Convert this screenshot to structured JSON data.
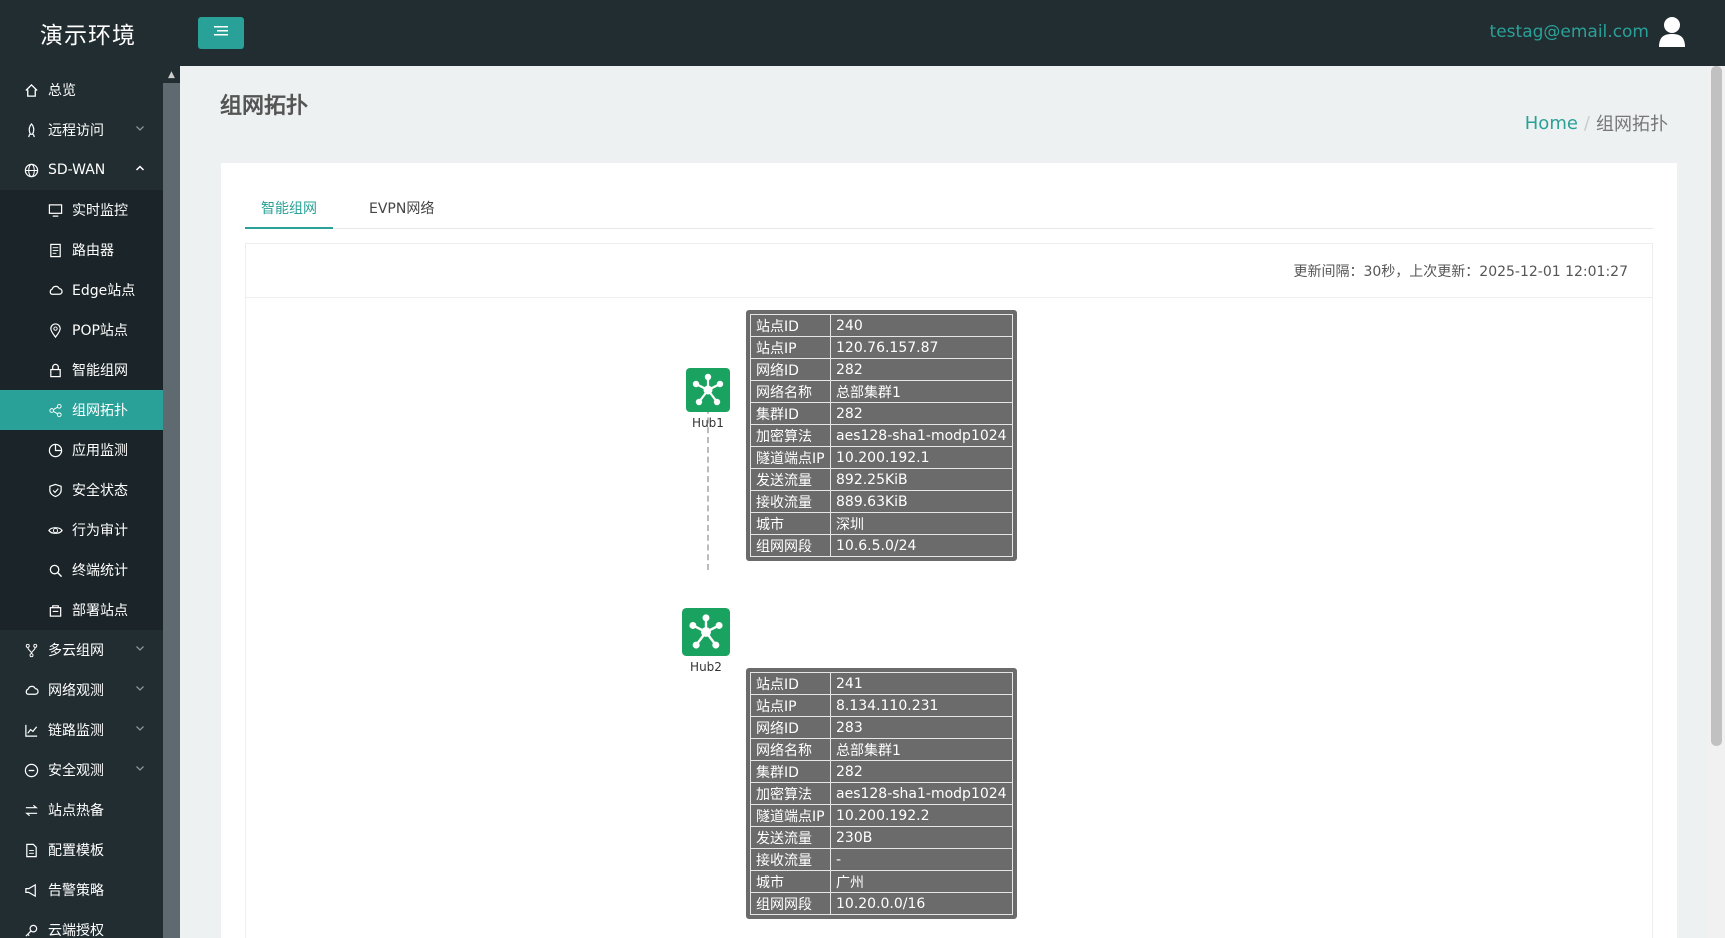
{
  "brand": "演示环境",
  "user": {
    "email": "testag@email.com"
  },
  "sidebar": {
    "items": [
      {
        "label": "总览",
        "icon": "home-icon"
      },
      {
        "label": "远程访问",
        "icon": "rocket-icon",
        "expandable": true
      },
      {
        "label": "SD-WAN",
        "icon": "globe-icon",
        "expandable": true,
        "expanded": true
      }
    ],
    "sdwan_sub": [
      {
        "label": "实时监控",
        "icon": "monitor-icon"
      },
      {
        "label": "路由器",
        "icon": "router-icon"
      },
      {
        "label": "Edge站点",
        "icon": "cloud-icon"
      },
      {
        "label": "POP站点",
        "icon": "location-pin-icon"
      },
      {
        "label": "智能组网",
        "icon": "lock-icon"
      },
      {
        "label": "组网拓扑",
        "icon": "share-nodes-icon",
        "active": true
      },
      {
        "label": "应用监测",
        "icon": "pie-chart-icon"
      },
      {
        "label": "安全状态",
        "icon": "shield-icon"
      },
      {
        "label": "行为审计",
        "icon": "eye-icon"
      },
      {
        "label": "终端统计",
        "icon": "search-icon"
      },
      {
        "label": "部署站点",
        "icon": "box-icon"
      }
    ],
    "bottom_items": [
      {
        "label": "多云组网",
        "icon": "fork-icon",
        "expandable": true
      },
      {
        "label": "网络观测",
        "icon": "cloud-icon",
        "expandable": true
      },
      {
        "label": "链路监测",
        "icon": "line-chart-icon",
        "expandable": true
      },
      {
        "label": "安全观测",
        "icon": "minus-circle-icon",
        "expandable": true
      },
      {
        "label": "站点热备",
        "icon": "swap-icon"
      },
      {
        "label": "配置模板",
        "icon": "file-icon"
      },
      {
        "label": "告警策略",
        "icon": "notification-icon"
      },
      {
        "label": "云端授权",
        "icon": "key-icon"
      }
    ]
  },
  "page": {
    "title": "组网拓扑"
  },
  "breadcrumb": {
    "home": "Home",
    "separator": "/",
    "current": "组网拓扑"
  },
  "tabs": [
    {
      "label": "智能组网",
      "active": true
    },
    {
      "label": "EVPN网络",
      "active": false
    }
  ],
  "update_info": "更新间隔：30秒，上次更新：2025-12-01 12:01:27",
  "topology": {
    "nodes": [
      {
        "label": "Hub1"
      },
      {
        "label": "Hub2"
      }
    ],
    "info_boxes": [
      {
        "rows": [
          {
            "k": "站点ID",
            "v": "240"
          },
          {
            "k": "站点IP",
            "v": "120.76.157.87"
          },
          {
            "k": "网络ID",
            "v": "282"
          },
          {
            "k": "网络名称",
            "v": "总部集群1"
          },
          {
            "k": "集群ID",
            "v": "282"
          },
          {
            "k": "加密算法",
            "v": "aes128-sha1-modp1024"
          },
          {
            "k": "隧道端点IP",
            "v": "10.200.192.1"
          },
          {
            "k": "发送流量",
            "v": "892.25KiB"
          },
          {
            "k": "接收流量",
            "v": "889.63KiB"
          },
          {
            "k": "城市",
            "v": "深圳"
          },
          {
            "k": "组网网段",
            "v": "10.6.5.0/24"
          }
        ]
      },
      {
        "rows": [
          {
            "k": "站点ID",
            "v": "241"
          },
          {
            "k": "站点IP",
            "v": "8.134.110.231"
          },
          {
            "k": "网络ID",
            "v": "283"
          },
          {
            "k": "网络名称",
            "v": "总部集群1"
          },
          {
            "k": "集群ID",
            "v": "282"
          },
          {
            "k": "加密算法",
            "v": "aes128-sha1-modp1024"
          },
          {
            "k": "隧道端点IP",
            "v": "10.200.192.2"
          },
          {
            "k": "发送流量",
            "v": "230B"
          },
          {
            "k": "接收流量",
            "v": "-"
          },
          {
            "k": "城市",
            "v": "广州"
          },
          {
            "k": "组网网段",
            "v": "10.20.0.0/16"
          }
        ]
      }
    ]
  },
  "colors": {
    "accent": "#2aa198",
    "sidebar_bg": "#222d32",
    "hub_green": "#1aa260",
    "info_bg": "#6b6b6b"
  }
}
